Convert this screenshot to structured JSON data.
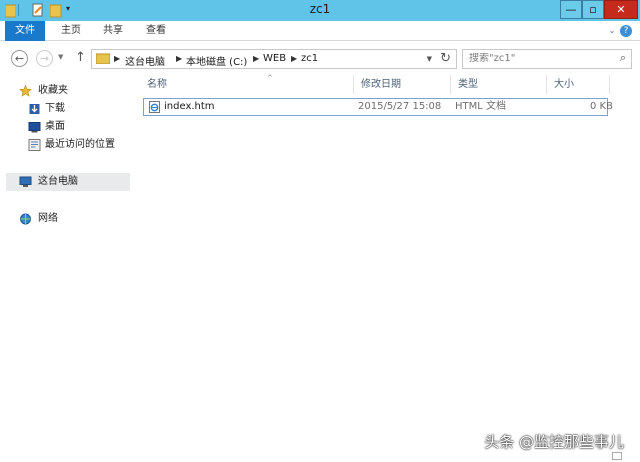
{
  "window": {
    "title": "zc1"
  },
  "titlebar": {
    "minimize_icon": "minimize-icon",
    "maximize_icon": "maximize-icon",
    "close_icon": "close-icon"
  },
  "ribbon": {
    "tabs": [
      {
        "label": "文件"
      },
      {
        "label": "主页"
      },
      {
        "label": "共享"
      },
      {
        "label": "查看"
      }
    ]
  },
  "navigation": {
    "back_icon": "back-icon",
    "forward_icon": "forward-icon",
    "up_icon": "up-arrow-icon"
  },
  "address": {
    "breadcrumbs": [
      "这台电脑",
      "本地磁盘 (C:)",
      "WEB",
      "zc1"
    ]
  },
  "search": {
    "placeholder": "搜索\"zc1\""
  },
  "sidebar": {
    "favorites": {
      "label": "收藏夹",
      "items": [
        {
          "label": "下载"
        },
        {
          "label": "桌面"
        },
        {
          "label": "最近访问的位置"
        }
      ]
    },
    "this_pc": {
      "label": "这台电脑"
    },
    "network": {
      "label": "网络"
    }
  },
  "file_list": {
    "columns": [
      "名称",
      "修改日期",
      "类型",
      "大小"
    ],
    "rows": [
      {
        "name": "index.htm",
        "modified": "2015/5/27 15:08",
        "type": "HTML 文档",
        "size": "0 KB"
      }
    ]
  },
  "watermark": "头条 @监控那些事儿",
  "colors": {
    "titlebar": "#5fc4e8",
    "file_tab": "#1979ca",
    "close_button": "#c42b1c",
    "selection_border": "#7da2ce"
  }
}
